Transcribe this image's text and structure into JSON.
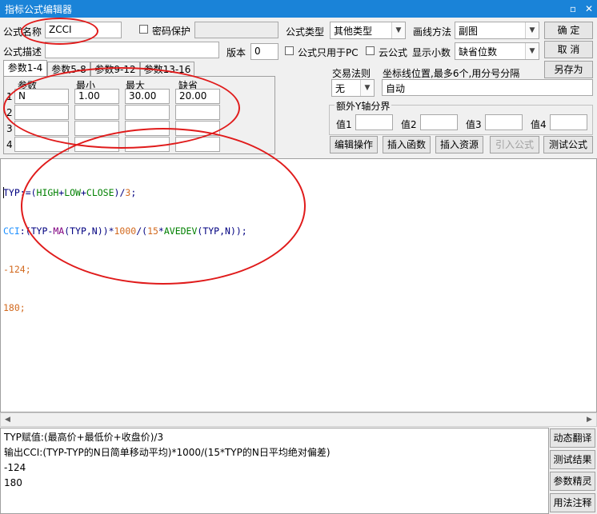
{
  "window": {
    "title": "指标公式编辑器",
    "minimize_icon": "restore-icon",
    "close_icon": "close-icon"
  },
  "form": {
    "name_label": "公式名称",
    "name_value": "ZCCI",
    "password_label": "密码保护",
    "password_checked": false,
    "desc_label": "公式描述",
    "desc_value": "",
    "type_label": "公式类型",
    "type_value": "其他类型",
    "draw_label": "画线方法",
    "draw_value": "副图",
    "version_label": "版本",
    "version_value": "0",
    "pc_only_label": "公式只用于PC",
    "cloud_label": "云公式",
    "decimals_label": "显示小数",
    "decimals_value": "缺省位数"
  },
  "buttons": {
    "ok": "确  定",
    "cancel": "取  消",
    "save_as": "另存为",
    "edit_op": "编辑操作",
    "insert_func": "插入函数",
    "insert_res": "插入资源",
    "import_formula": "引入公式",
    "test_formula": "测试公式"
  },
  "param_tabs": [
    "参数1-4",
    "参数5-8",
    "参数9-12",
    "参数13-16"
  ],
  "param_headers": {
    "name": "参数",
    "min": "最小",
    "max": "最大",
    "default": "缺省"
  },
  "params": [
    {
      "idx": "1",
      "name": "N",
      "min": "1.00",
      "max": "30.00",
      "default": "20.00"
    },
    {
      "idx": "2",
      "name": "",
      "min": "",
      "max": "",
      "default": ""
    },
    {
      "idx": "3",
      "name": "",
      "min": "",
      "max": "",
      "default": ""
    },
    {
      "idx": "4",
      "name": "",
      "min": "",
      "max": "",
      "default": ""
    }
  ],
  "trade_rule": {
    "label": "交易法则",
    "value": "无"
  },
  "coord": {
    "label": "坐标线位置,最多6个,用分号分隔",
    "value": "自动"
  },
  "extra_y": {
    "label": "额外Y轴分界",
    "v1": "值1",
    "v2": "值2",
    "v3": "值3",
    "v4": "值4"
  },
  "code": {
    "line1": [
      {
        "t": "TYP:=(",
        "c": "#000080"
      },
      {
        "t": "HIGH",
        "c": "#008000"
      },
      {
        "t": "+",
        "c": "#000080"
      },
      {
        "t": "LOW",
        "c": "#008000"
      },
      {
        "t": "+",
        "c": "#000080"
      },
      {
        "t": "CLOSE",
        "c": "#008000"
      },
      {
        "t": ")/",
        "c": "#000080"
      },
      {
        "t": "3",
        "c": "#d2691e"
      },
      {
        "t": ";",
        "c": "#000080"
      }
    ],
    "line2": [
      {
        "t": "CCI",
        "c": "#1e90ff"
      },
      {
        "t": ":(TYP-",
        "c": "#000080"
      },
      {
        "t": "MA",
        "c": "#800080"
      },
      {
        "t": "(TYP,N))*",
        "c": "#000080"
      },
      {
        "t": "1000",
        "c": "#d2691e"
      },
      {
        "t": "/(",
        "c": "#000080"
      },
      {
        "t": "15",
        "c": "#d2691e"
      },
      {
        "t": "*",
        "c": "#000080"
      },
      {
        "t": "AVEDEV",
        "c": "#008000"
      },
      {
        "t": "(TYP,N));",
        "c": "#000080"
      }
    ],
    "line3": [
      {
        "t": "-124;",
        "c": "#d2691e"
      }
    ],
    "line4": [
      {
        "t": "180;",
        "c": "#d2691e"
      }
    ]
  },
  "output": [
    "TYP赋值:(最高价+最低价+收盘价)/3",
    "输出CCI:(TYP-TYP的N日简单移动平均)*1000/(15*TYP的N日平均绝对偏差)",
    "-124",
    "180"
  ],
  "side_buttons": [
    "动态翻译",
    "测试结果",
    "参数精灵",
    "用法注释"
  ],
  "colors": {
    "titlebar": "#1a83d8",
    "annotation": "#e01b1b"
  }
}
